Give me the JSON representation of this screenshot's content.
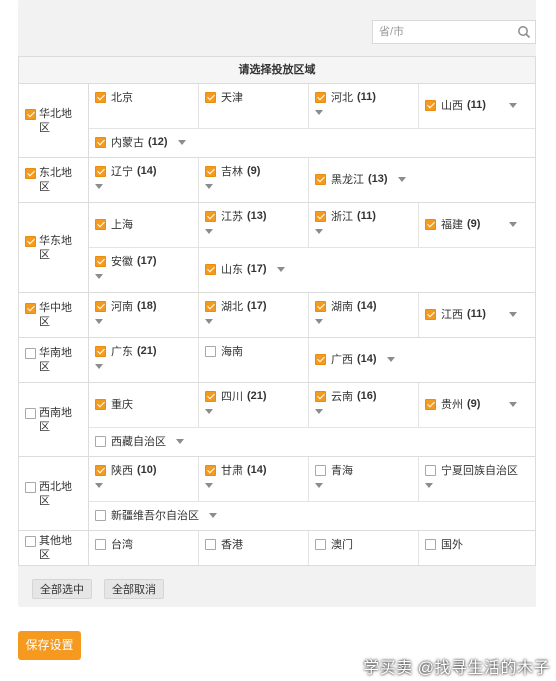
{
  "search": {
    "placeholder": "省/市",
    "value": ""
  },
  "table_title": "请选择投放区域",
  "colors": {
    "accent": "#f39a1f",
    "button_primary": "#f59a1f"
  },
  "regions": [
    {
      "label": "华北地区",
      "checked": true,
      "rows": [
        [
          {
            "name": "北京",
            "checked": true,
            "count": ""
          },
          {
            "name": "天津",
            "checked": true,
            "count": ""
          },
          {
            "name": "河北",
            "checked": true,
            "count": "(11)",
            "arrow": "below"
          },
          {
            "name": "山西",
            "checked": true,
            "count": "(11)",
            "arrow": "right",
            "mid": true
          }
        ],
        [
          {
            "name": "内蒙古",
            "checked": true,
            "count": "(12)",
            "arrow": "inline",
            "wide": true
          }
        ]
      ]
    },
    {
      "label": "东北地区",
      "checked": true,
      "rows": [
        [
          {
            "name": "辽宁",
            "checked": true,
            "count": "(14)",
            "arrow": "below"
          },
          {
            "name": "吉林",
            "checked": true,
            "count": "(9)",
            "arrow": "below"
          },
          {
            "name": "黑龙江",
            "checked": true,
            "count": "(13)",
            "arrow": "inline",
            "span": 2,
            "mid": true
          }
        ]
      ]
    },
    {
      "label": "华东地区",
      "checked": true,
      "rows": [
        [
          {
            "name": "上海",
            "checked": true,
            "count": "",
            "mid": true
          },
          {
            "name": "江苏",
            "checked": true,
            "count": "(13)",
            "arrow": "below"
          },
          {
            "name": "浙江",
            "checked": true,
            "count": "(11)",
            "arrow": "below"
          },
          {
            "name": "福建",
            "checked": true,
            "count": "(9)",
            "arrow": "right",
            "mid": true
          }
        ],
        [
          {
            "name": "安徽",
            "checked": true,
            "count": "(17)",
            "arrow": "below"
          },
          {
            "name": "山东",
            "checked": true,
            "count": "(17)",
            "arrow": "inline",
            "span": 3,
            "mid": true
          }
        ]
      ]
    },
    {
      "label": "华中地区",
      "checked": true,
      "rows": [
        [
          {
            "name": "河南",
            "checked": true,
            "count": "(18)",
            "arrow": "below"
          },
          {
            "name": "湖北",
            "checked": true,
            "count": "(17)",
            "arrow": "below"
          },
          {
            "name": "湖南",
            "checked": true,
            "count": "(14)",
            "arrow": "below"
          },
          {
            "name": "江西",
            "checked": true,
            "count": "(11)",
            "arrow": "right",
            "mid": true
          }
        ]
      ]
    },
    {
      "label": "华南地区",
      "checked": false,
      "rows": [
        [
          {
            "name": "广东",
            "checked": true,
            "count": "(21)",
            "arrow": "below"
          },
          {
            "name": "海南",
            "checked": false,
            "count": ""
          },
          {
            "name": "广西",
            "checked": true,
            "count": "(14)",
            "arrow": "inline",
            "span": 2,
            "mid": true
          }
        ]
      ]
    },
    {
      "label": "西南地区",
      "checked": false,
      "rows": [
        [
          {
            "name": "重庆",
            "checked": true,
            "count": "",
            "mid": true
          },
          {
            "name": "四川",
            "checked": true,
            "count": "(21)",
            "arrow": "below"
          },
          {
            "name": "云南",
            "checked": true,
            "count": "(16)",
            "arrow": "below"
          },
          {
            "name": "贵州",
            "checked": true,
            "count": "(9)",
            "arrow": "right",
            "mid": true
          }
        ],
        [
          {
            "name": "西藏自治区",
            "checked": false,
            "count": "",
            "arrow": "inline",
            "wide": true
          }
        ]
      ]
    },
    {
      "label": "西北地区",
      "checked": false,
      "rows": [
        [
          {
            "name": "陕西",
            "checked": true,
            "count": "(10)",
            "arrow": "below"
          },
          {
            "name": "甘肃",
            "checked": true,
            "count": "(14)",
            "arrow": "below"
          },
          {
            "name": "青海",
            "checked": false,
            "count": "",
            "arrow": "below"
          },
          {
            "name": "宁夏回族自治区",
            "checked": false,
            "count": "",
            "arrow": "below"
          }
        ],
        [
          {
            "name": "新疆维吾尔自治区",
            "checked": false,
            "count": "",
            "arrow": "inline",
            "wide": true
          }
        ]
      ]
    },
    {
      "label": "其他地区",
      "checked": false,
      "rows": [
        [
          {
            "name": "台湾",
            "checked": false,
            "count": "",
            "mid": true
          },
          {
            "name": "香港",
            "checked": false,
            "count": "",
            "mid": true
          },
          {
            "name": "澳门",
            "checked": false,
            "count": "",
            "mid": true
          },
          {
            "name": "国外",
            "checked": false,
            "count": "",
            "mid": true
          }
        ]
      ]
    }
  ],
  "buttons": {
    "select_all": "全部选中",
    "deselect_all": "全部取消",
    "save": "保存设置"
  },
  "watermark": "学买卖 @找寻生活的木子"
}
